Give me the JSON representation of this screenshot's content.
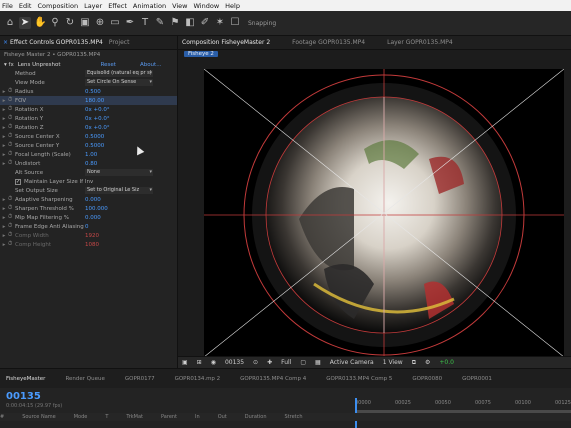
{
  "menu": [
    "File",
    "Edit",
    "Composition",
    "Layer",
    "Effect",
    "Animation",
    "View",
    "Window",
    "Help"
  ],
  "toolbar": {
    "snapping_label": "Snapping"
  },
  "effect_controls": {
    "tab_label": "Effect Controls GOPR0135.MP4",
    "project_tab": "Project",
    "breadcrumb": "Fisheye Master 2 • GOPR0135.MP4",
    "effect_name": "Lens Unpreshot",
    "reset_label": "Reset",
    "about_label": "About...",
    "properties": [
      {
        "name": "Method",
        "value": "Equisolid (natural eq pr s)",
        "kind": "dropdown"
      },
      {
        "name": "View Mode",
        "value": "Set Circle On Sense",
        "kind": "dropdown"
      },
      {
        "name": "Radius",
        "value": "0.500",
        "kind": "value"
      },
      {
        "name": "FOV",
        "value": "180.00",
        "kind": "value",
        "selected": true
      },
      {
        "name": "Rotation X",
        "value": "0x +0.0°",
        "kind": "value"
      },
      {
        "name": "Rotation Y",
        "value": "0x +0.0°",
        "kind": "value"
      },
      {
        "name": "Rotation Z",
        "value": "0x +0.0°",
        "kind": "value"
      },
      {
        "name": "Source Center X",
        "value": "0.5000",
        "kind": "value"
      },
      {
        "name": "Source Center Y",
        "value": "0.5000",
        "kind": "value"
      },
      {
        "name": "Focal Length (Scale)",
        "value": "1.00",
        "kind": "value"
      },
      {
        "name": "Undistort",
        "value": "0.80",
        "kind": "value"
      },
      {
        "name": "Alt Source",
        "value": "None",
        "kind": "dropdown"
      },
      {
        "name": "Maintain Layer Size If Inv",
        "value": "",
        "kind": "checkbox"
      },
      {
        "name": "Set Output Size",
        "value": "Set to Original Le Siz",
        "kind": "dropdown"
      },
      {
        "name": "Adaptive Sharpening",
        "value": "0.000",
        "kind": "value"
      },
      {
        "name": "Sharpen Threshold %",
        "value": "100.000",
        "kind": "value"
      },
      {
        "name": "Mip Map Filtering %",
        "value": "0.000",
        "kind": "value"
      },
      {
        "name": "Frame Edge Anti Aliasing",
        "value": "0",
        "kind": "value"
      },
      {
        "name": "Comp Width",
        "value": "1920",
        "kind": "value",
        "dim": true
      },
      {
        "name": "Comp Height",
        "value": "1080",
        "kind": "value",
        "dim": true
      }
    ]
  },
  "composition": {
    "tabs": [
      "Composition FisheyeMaster 2",
      "Footage GOPR0135.MP4",
      "Layer GOPR0135.MP4"
    ],
    "subtab": "Fisheye 2",
    "footer": {
      "timecode": "00135",
      "zoom": "Full",
      "camera": "Active Camera",
      "views": "1 View",
      "exposure": "+0.0"
    }
  },
  "timeline": {
    "tabs": [
      "FisheyeMaster",
      "Render Queue",
      "GOPR0177",
      "GOPR0134.mp 2",
      "GOPR0135.MP4 Comp 4",
      "GOPR0133.MP4 Comp 5",
      "GOPR0080",
      "GOPR0001"
    ],
    "timecode": "00135",
    "timecode_sub": "0:00:04:15 (29.97 fps)",
    "columns": [
      "#",
      "Source Name",
      "Mode",
      "T",
      "TrkMat",
      "Parent",
      "In",
      "Out",
      "Duration",
      "Stretch"
    ],
    "ruler": [
      "00000",
      "00025",
      "00050",
      "00075",
      "00100",
      "00125"
    ]
  },
  "colors": {
    "accent": "#4a9bff",
    "selection": "#2a5ea8",
    "guide_red": "#c23a3a",
    "guide_white": "#e6e6e6"
  }
}
